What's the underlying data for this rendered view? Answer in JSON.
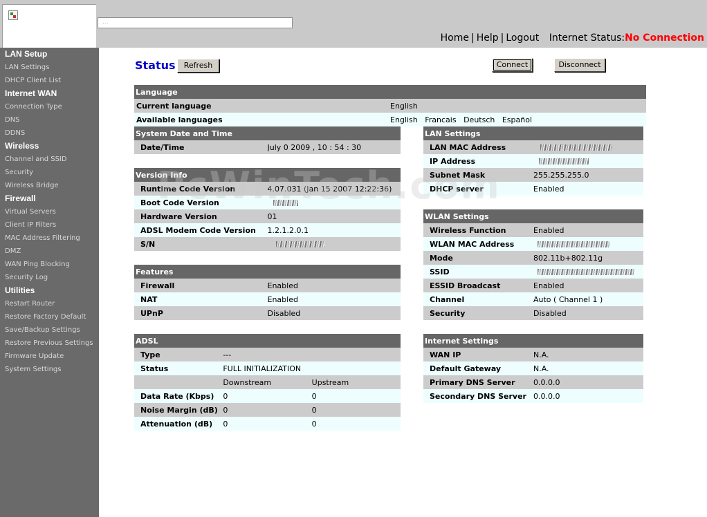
{
  "header": {
    "banner_text": "...",
    "nav": {
      "home": "Home",
      "help": "Help",
      "logout": "Logout",
      "sep": "|"
    },
    "internet_status_label": "Internet Status:",
    "internet_status_value": "No Connection",
    "status_color": "#ff0000"
  },
  "sidebar": {
    "groups": [
      {
        "label": "LAN Setup",
        "items": [
          "LAN Settings",
          "DHCP Client List"
        ]
      },
      {
        "label": "Internet WAN",
        "items": [
          "Connection Type",
          "DNS",
          "DDNS"
        ]
      },
      {
        "label": "Wireless",
        "items": [
          "Channel and SSID",
          "Security",
          "Wireless Bridge"
        ]
      },
      {
        "label": "Firewall",
        "items": [
          "Virtual Servers",
          "Client IP Filters",
          "MAC Address Filtering",
          "DMZ",
          "WAN Ping Blocking",
          "Security Log"
        ]
      },
      {
        "label": "Utilities",
        "items": [
          "Restart Router",
          "Restore Factory Default",
          "Save/Backup Settings",
          "Restore Previous Settings",
          "Firmware Update",
          "System Settings"
        ]
      }
    ]
  },
  "main": {
    "title": "Status",
    "title_color": "#0000cc",
    "refresh_label": "Refresh",
    "connect_label": "Connect",
    "disconnect_label": "Disconnect",
    "watermark": "PcWinTech.com",
    "language": {
      "header": "Language",
      "current_label": "Current language",
      "current_value": "English",
      "available_label": "Available languages",
      "available": [
        "English",
        "Francais",
        "Deutsch",
        "Español"
      ]
    },
    "system_date": {
      "header": "System Date and Time",
      "rows": [
        {
          "label": "Date/Time",
          "value": "July 0 2009 , 10 : 54 : 30"
        }
      ]
    },
    "version": {
      "header": "Version Info",
      "rows": [
        {
          "label": "Runtime Code Version",
          "value": "4.07.031 (Jan 15 2007 12:22:36)"
        },
        {
          "label": "Boot Code Version",
          "value": ""
        },
        {
          "label": "Hardware Version",
          "value": "01"
        },
        {
          "label": "ADSL Modem Code Version",
          "value": "1.2.1.2.0.1"
        },
        {
          "label": "S/N",
          "value": ""
        }
      ]
    },
    "features": {
      "header": "Features",
      "rows": [
        {
          "label": "Firewall",
          "value": "Enabled"
        },
        {
          "label": "NAT",
          "value": "Enabled"
        },
        {
          "label": "UPnP",
          "value": "Disabled"
        }
      ]
    },
    "adsl": {
      "header": "ADSL",
      "type_label": "Type",
      "type_value": "---",
      "status_label": "Status",
      "status_value": "FULL INITIALIZATION",
      "col_downstream": "Downstream",
      "col_upstream": "Upstream",
      "rows": [
        {
          "label": "Data Rate (Kbps)",
          "down": "0",
          "up": "0"
        },
        {
          "label": "Noise Margin (dB)",
          "down": "0",
          "up": "0"
        },
        {
          "label": "Attenuation (dB)",
          "down": "0",
          "up": "0"
        }
      ]
    },
    "lan_settings": {
      "header": "LAN Settings",
      "rows": [
        {
          "label": "LAN MAC Address",
          "value": ""
        },
        {
          "label": "IP Address",
          "value": ""
        },
        {
          "label": "Subnet Mask",
          "value": "255.255.255.0"
        },
        {
          "label": "DHCP server",
          "value": "Enabled"
        }
      ]
    },
    "wlan_settings": {
      "header": "WLAN Settings",
      "rows": [
        {
          "label": "Wireless Function",
          "value": "Enabled"
        },
        {
          "label": "WLAN MAC Address",
          "value": ""
        },
        {
          "label": "Mode",
          "value": "802.11b+802.11g"
        },
        {
          "label": "SSID",
          "value": ""
        },
        {
          "label": "ESSID Broadcast",
          "value": "Enabled"
        },
        {
          "label": "Channel",
          "value": "Auto ( Channel 1 )"
        },
        {
          "label": "Security",
          "value": "Disabled"
        }
      ]
    },
    "internet_settings": {
      "header": "Internet Settings",
      "rows": [
        {
          "label": "WAN IP",
          "value": "N.A."
        },
        {
          "label": "Default Gateway",
          "value": "N.A."
        },
        {
          "label": "Primary DNS Server",
          "value": "0.0.0.0"
        },
        {
          "label": "Secondary DNS Server",
          "value": "0.0.0.0"
        }
      ]
    }
  }
}
